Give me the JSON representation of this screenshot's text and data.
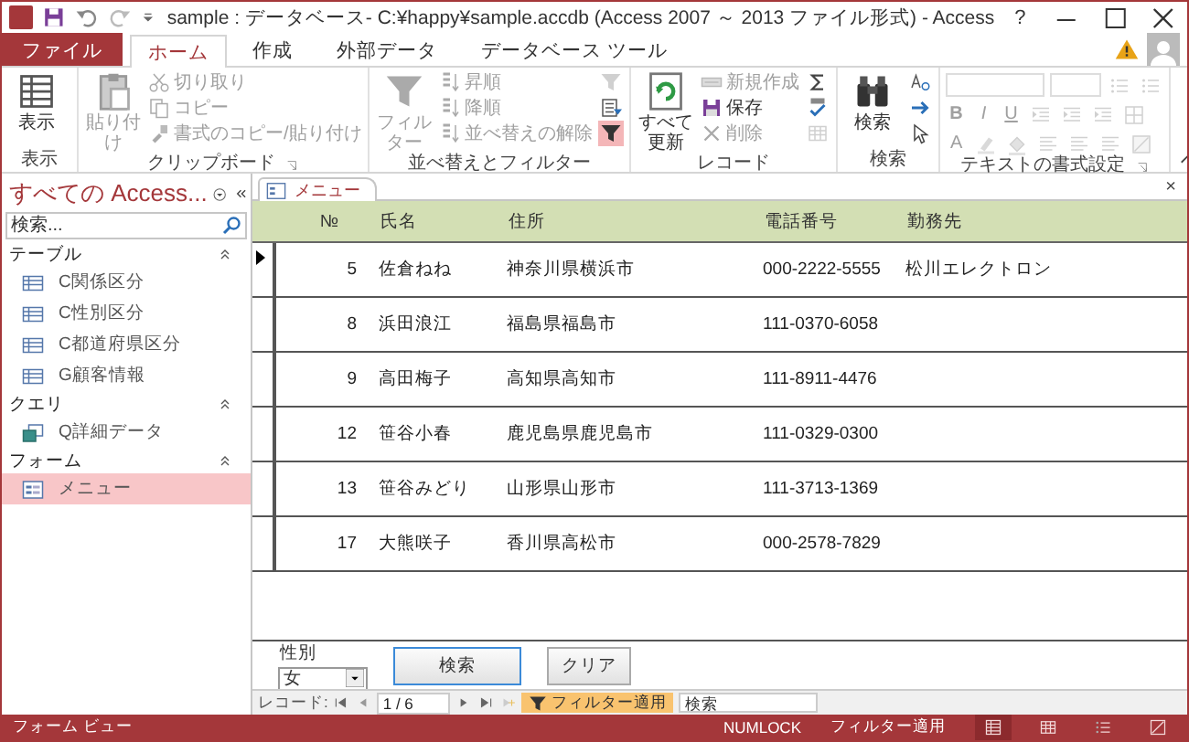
{
  "window": {
    "title": "sample : データベース- C:¥happy¥sample.accdb (Access 2007 ～ 2013 ファイル形式) - Access",
    "help": "?"
  },
  "tabs": [
    {
      "label": "ファイル",
      "kind": "file",
      "selected": false
    },
    {
      "label": "ホーム",
      "kind": "tab",
      "selected": true
    },
    {
      "label": "作成",
      "kind": "tab",
      "selected": false
    },
    {
      "label": "外部データ",
      "kind": "tab",
      "selected": false
    },
    {
      "label": "データベース ツール",
      "kind": "tab",
      "selected": false
    }
  ],
  "ribbon": {
    "groups": [
      {
        "label": "表示",
        "launcher": false,
        "items": [
          {
            "kind": "large",
            "label": "表示",
            "disabled": false
          }
        ]
      },
      {
        "label": "クリップボード",
        "launcher": true,
        "items": [
          {
            "kind": "large",
            "label": "貼り付け",
            "disabled": true
          },
          {
            "kind": "small",
            "label": "切り取り",
            "disabled": true
          },
          {
            "kind": "small",
            "label": "コピー",
            "disabled": true
          },
          {
            "kind": "small",
            "label": "書式のコピー/貼り付け",
            "disabled": true
          }
        ]
      },
      {
        "label": "並べ替えとフィルター",
        "launcher": false,
        "items": [
          {
            "kind": "large",
            "label": "フィルター",
            "disabled": true
          },
          {
            "kind": "small",
            "label": "昇順",
            "disabled": true
          },
          {
            "kind": "small",
            "label": "降順",
            "disabled": true
          },
          {
            "kind": "small",
            "label": "並べ替えの解除",
            "disabled": true
          },
          {
            "kind": "icon",
            "disabled": true,
            "on": false
          },
          {
            "kind": "icon",
            "disabled": false,
            "on": false
          },
          {
            "kind": "icon",
            "disabled": false,
            "on": true
          }
        ]
      },
      {
        "label": "レコード",
        "launcher": false,
        "items": [
          {
            "kind": "large",
            "label": "すべて更新",
            "disabled": false
          },
          {
            "kind": "small",
            "label": "新規作成",
            "disabled": true
          },
          {
            "kind": "small",
            "label": "保存",
            "disabled": false
          },
          {
            "kind": "small",
            "label": "削除",
            "disabled": true
          },
          {
            "kind": "icon",
            "disabled": false,
            "on": false
          },
          {
            "kind": "icon",
            "disabled": false,
            "on": false
          },
          {
            "kind": "icon",
            "disabled": true,
            "on": false
          }
        ]
      },
      {
        "label": "検索",
        "launcher": false,
        "items": [
          {
            "kind": "large",
            "label": "検索",
            "disabled": false
          },
          {
            "kind": "icon",
            "disabled": false,
            "on": false
          },
          {
            "kind": "icon",
            "disabled": false,
            "on": false
          },
          {
            "kind": "icon",
            "disabled": false,
            "on": false
          }
        ]
      },
      {
        "label": "テキストの書式設定",
        "launcher": true,
        "rows": [
          [
            {
              "kind": "combo",
              "disabled": true
            },
            {
              "kind": "combo",
              "disabled": true
            },
            {
              "kind": "icon",
              "disabled": true
            },
            {
              "kind": "icon",
              "disabled": true
            }
          ],
          [
            {
              "kind": "glyph",
              "label": "B",
              "disabled": true
            },
            {
              "kind": "glyph",
              "label": "I",
              "disabled": true
            },
            {
              "kind": "glyph",
              "label": "U",
              "disabled": true
            },
            {
              "kind": "icon",
              "disabled": true
            },
            {
              "kind": "icon",
              "disabled": true
            },
            {
              "kind": "icon",
              "disabled": true
            },
            {
              "kind": "icon",
              "disabled": true
            }
          ],
          [
            {
              "kind": "glyph",
              "label": "A",
              "disabled": true
            },
            {
              "kind": "icon",
              "disabled": true
            },
            {
              "kind": "icon",
              "disabled": true
            },
            {
              "kind": "icon",
              "disabled": true
            },
            {
              "kind": "icon",
              "disabled": true
            },
            {
              "kind": "icon",
              "disabled": true
            },
            {
              "kind": "icon",
              "disabled": true
            }
          ]
        ]
      }
    ]
  },
  "nav_pane": {
    "title": "すべての Access...",
    "search": {
      "placeholder": "検索..."
    },
    "sections": [
      {
        "label": "テーブル",
        "expanded": true,
        "kind": "table",
        "items": [
          {
            "label": "C関係区分",
            "selected": false
          },
          {
            "label": "C性別区分",
            "selected": false
          },
          {
            "label": "C都道府県区分",
            "selected": false
          },
          {
            "label": "G顧客情報",
            "selected": false
          }
        ]
      },
      {
        "label": "クエリ",
        "expanded": true,
        "kind": "query",
        "items": [
          {
            "label": "Q詳細データ",
            "selected": false
          }
        ]
      },
      {
        "label": "フォーム",
        "expanded": true,
        "kind": "form",
        "items": [
          {
            "label": "メニュー",
            "selected": true
          }
        ]
      }
    ]
  },
  "document": {
    "tab": "メニュー",
    "close": "×",
    "table": {
      "columns": [
        "№",
        "氏名",
        "住所",
        "電話番号",
        "勤務先"
      ],
      "rows": [
        {
          "current": true,
          "cells": [
            "5",
            "佐倉ねね",
            "神奈川県横浜市",
            "000-2222-5555",
            "松川エレクトロン"
          ]
        },
        {
          "current": false,
          "cells": [
            "8",
            "浜田浪江",
            "福島県福島市",
            "111-0370-6058",
            ""
          ]
        },
        {
          "current": false,
          "cells": [
            "9",
            "高田梅子",
            "高知県高知市",
            "111-8911-4476",
            ""
          ]
        },
        {
          "current": false,
          "cells": [
            "12",
            "笹谷小春",
            "鹿児島県鹿児島市",
            "111-0329-0300",
            ""
          ]
        },
        {
          "current": false,
          "cells": [
            "13",
            "笹谷みどり",
            "山形県山形市",
            "111-3713-1369",
            ""
          ]
        },
        {
          "current": false,
          "cells": [
            "17",
            "大熊咲子",
            "香川県高松市",
            "000-2578-7829",
            ""
          ]
        }
      ]
    },
    "footer": {
      "gender_label": "性別",
      "gender_value": "女",
      "buttons": [
        {
          "label": "検索",
          "focused": true
        },
        {
          "label": "クリア",
          "focused": false
        }
      ]
    },
    "record_nav": {
      "label": "レコード:",
      "position": "1 / 6",
      "filter": "フィルター適用",
      "filtered": true,
      "search": {
        "placeholder": "検索"
      }
    }
  },
  "status_bar": {
    "view": "フォーム ビュー",
    "indicators": [
      "NUMLOCK",
      "フィルター適用"
    ],
    "views": [
      {
        "selected": true
      },
      {
        "selected": false
      },
      {
        "selected": false
      },
      {
        "selected": false
      }
    ]
  }
}
